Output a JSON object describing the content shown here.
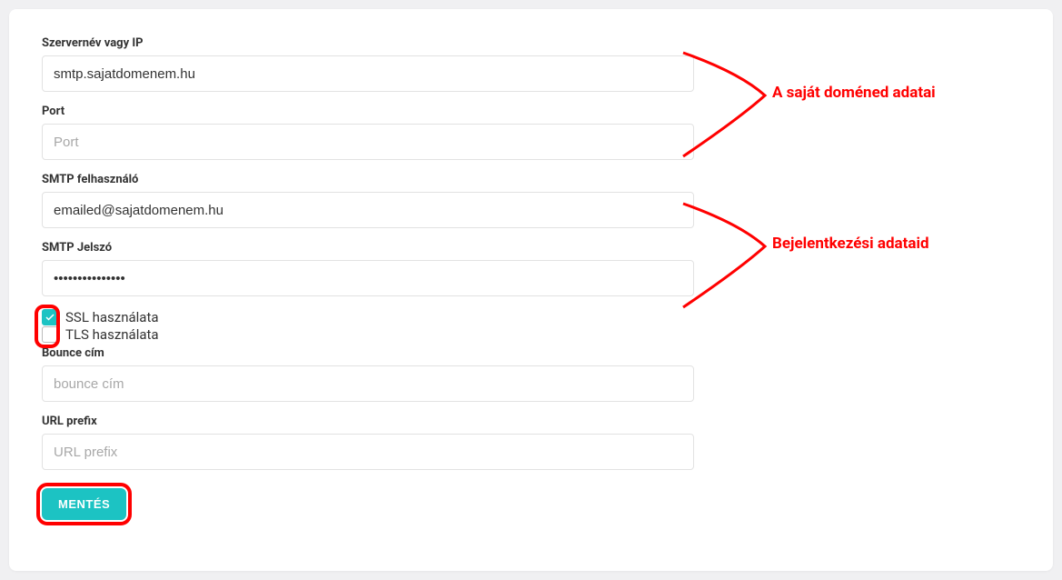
{
  "annotations": {
    "domain_data": "A saját doméned adatai",
    "login_data": "Bejelentkezési adataid"
  },
  "form": {
    "server": {
      "label": "Szervernév vagy IP",
      "value": "smtp.sajatdomenem.hu"
    },
    "port": {
      "label": "Port",
      "placeholder": "Port",
      "value": ""
    },
    "smtp_user": {
      "label": "SMTP felhasználó",
      "value": "emailed@sajatdomenem.hu"
    },
    "smtp_pass": {
      "label": "SMTP Jelszó",
      "value": "•••••••••••••••"
    },
    "ssl": {
      "label": "SSL használata",
      "checked": true
    },
    "tls": {
      "label": "TLS használata",
      "checked": false
    },
    "bounce": {
      "label": "Bounce cím",
      "placeholder": "bounce cím",
      "value": ""
    },
    "url_prefix": {
      "label": "URL prefix",
      "placeholder": "URL prefix",
      "value": ""
    },
    "save_button": "MENTÉS"
  }
}
